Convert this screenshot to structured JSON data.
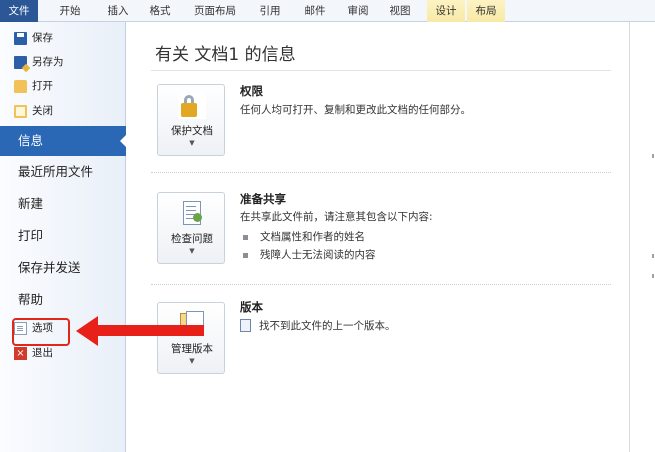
{
  "ribbon": {
    "tabs": [
      "文件",
      "开始",
      "插入",
      "格式",
      "页面布局",
      "引用",
      "邮件",
      "审阅",
      "视图",
      "设计",
      "布局"
    ]
  },
  "sidebar": {
    "save": "保存",
    "save_as": "另存为",
    "open": "打开",
    "close": "关闭",
    "info": "信息",
    "recent": "最近所用文件",
    "new": "新建",
    "print": "打印",
    "save_send": "保存并发送",
    "help": "帮助",
    "options": "选项",
    "exit": "退出"
  },
  "main": {
    "title": "有关 文档1 的信息",
    "permissions": {
      "button_label": "保护文档",
      "heading": "权限",
      "description": "任何人均可打开、复制和更改此文档的任何部分。"
    },
    "prepare": {
      "button_label": "检查问题",
      "heading": "准备共享",
      "description": "在共享此文件前，请注意其包含以下内容:",
      "bullets": [
        "文档属性和作者的姓名",
        "残障人士无法阅读的内容"
      ]
    },
    "versions": {
      "button_label": "管理版本",
      "heading": "版本",
      "description": "找不到此文件的上一个版本。"
    }
  },
  "colors": {
    "file_tab": "#2b5797",
    "active_nav": "#2a67b4",
    "annotation_red": "#e8201a"
  }
}
